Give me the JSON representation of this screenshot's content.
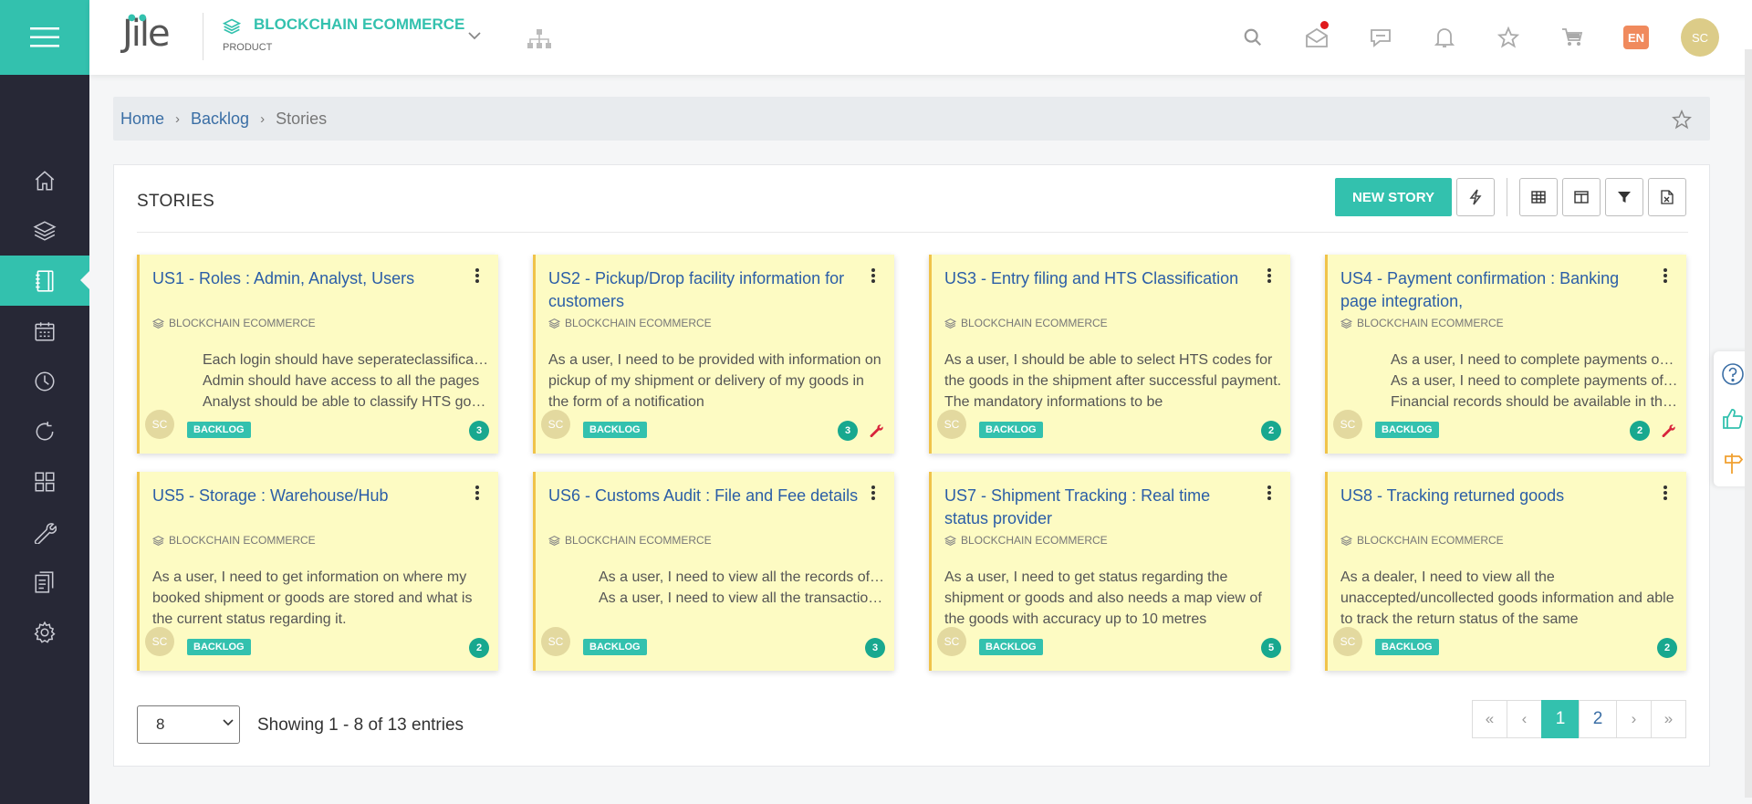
{
  "app": {
    "logo_text": "Jile",
    "project_name": "BLOCKCHAIN ECOMMERCE",
    "project_type": "PRODUCT",
    "language": "EN",
    "user_initials": "SC"
  },
  "sidebar": {
    "items": [
      {
        "name": "home",
        "icon": "home-icon"
      },
      {
        "name": "layers",
        "icon": "layers-icon"
      },
      {
        "name": "backlog",
        "icon": "notebook-icon",
        "active": true
      },
      {
        "name": "calendar",
        "icon": "calendar-icon"
      },
      {
        "name": "clock",
        "icon": "clock-icon"
      },
      {
        "name": "refresh",
        "icon": "refresh-icon"
      },
      {
        "name": "apps",
        "icon": "grid-icon"
      },
      {
        "name": "tools",
        "icon": "wrench-icon"
      },
      {
        "name": "docs",
        "icon": "documents-icon"
      },
      {
        "name": "settings",
        "icon": "gear-icon"
      }
    ]
  },
  "breadcrumb": {
    "home": "Home",
    "backlog": "Backlog",
    "current": "Stories"
  },
  "panel": {
    "title": "STORIES",
    "new_story_label": "NEW STORY"
  },
  "cards": [
    {
      "title": "US1 - Roles : Admin, Analyst, Users",
      "project": "BLOCKCHAIN ECOMMERCE",
      "bullets": [
        "Each login should have seperateclassification",
        "Admin should have access to all the pages",
        "Analyst should be able to classify HTS goods"
      ],
      "desc": "",
      "avatar": "SC",
      "status": "BACKLOG",
      "count": "3",
      "wrench": false
    },
    {
      "title": "US2 - Pickup/Drop facility information for customers",
      "project": "BLOCKCHAIN ECOMMERCE",
      "bullets": [],
      "desc": "As a user, I need to be provided with information on pickup of my shipment or delivery of my goods in the form of a notification",
      "avatar": "SC",
      "status": "BACKLOG",
      "count": "3",
      "wrench": true
    },
    {
      "title": "US3 - Entry filing and HTS Classification",
      "project": "BLOCKCHAIN ECOMMERCE",
      "bullets": [],
      "desc": "As a user, I should be able to select HTS codes for the goods in the shipment after successful payment. The mandatory informations to be",
      "avatar": "SC",
      "status": "BACKLOG",
      "count": "2",
      "wrench": false
    },
    {
      "title": "US4 - Payment confirmation : Banking page integration,",
      "project": "BLOCKCHAIN ECOMMERCE",
      "bullets": [
        "As a user, I need to complete payments online",
        "As a user, I need to complete payments offline",
        "Financial records should be available in the system"
      ],
      "desc": "",
      "avatar": "SC",
      "status": "BACKLOG",
      "count": "2",
      "wrench": true
    },
    {
      "title": "US5 - Storage : Warehouse/Hub",
      "project": "BLOCKCHAIN ECOMMERCE",
      "bullets": [],
      "desc": "As a user, I need to get information on where my booked shipment or goods are stored and what is the current status regarding it.",
      "avatar": "SC",
      "status": "BACKLOG",
      "count": "2",
      "wrench": false
    },
    {
      "title": "US6 - Customs Audit : File and Fee details",
      "project": "BLOCKCHAIN ECOMMERCE",
      "bullets": [
        "As a user, I need to view all the records of audit",
        "As a user, I need to view all the transaction fees"
      ],
      "desc": "",
      "avatar": "SC",
      "status": "BACKLOG",
      "count": "3",
      "wrench": false
    },
    {
      "title": "US7 - Shipment Tracking : Real time status provider",
      "project": "BLOCKCHAIN ECOMMERCE",
      "bullets": [],
      "desc": "As a user, I need to get status regarding the shipment or goods and also needs a map view of the goods with accuracy up to 10 metres",
      "avatar": "SC",
      "status": "BACKLOG",
      "count": "5",
      "wrench": false
    },
    {
      "title": "US8 - Tracking returned goods",
      "project": "BLOCKCHAIN ECOMMERCE",
      "bullets": [],
      "desc": "As a dealer, I need to view all the unaccepted/uncollected goods information and able to track the return status of the same",
      "avatar": "SC",
      "status": "BACKLOG",
      "count": "2",
      "wrench": false
    }
  ],
  "footer": {
    "page_size": "8",
    "showing": "Showing 1 - 8 of 13 entries",
    "pager": {
      "first": "«",
      "prev": "‹",
      "pages": [
        "1",
        "2"
      ],
      "current": "1",
      "next": "›",
      "last": "»"
    }
  },
  "colors": {
    "accent": "#33c1ae",
    "sidebar_bg": "#272836",
    "card_bg": "#fdfbc3",
    "card_border": "#f0c34a",
    "title_blue": "#2b5ea7"
  }
}
